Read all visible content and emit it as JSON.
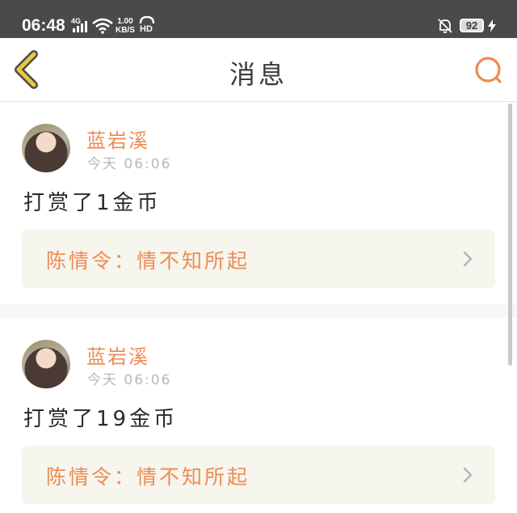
{
  "status_bar": {
    "time": "06:48",
    "network": "4G",
    "speed_value": "1.00",
    "speed_unit": "KB/S",
    "hd": "HD",
    "battery": "92"
  },
  "header": {
    "title": "消息"
  },
  "icons": {
    "back": "chevron-left-icon",
    "search": "search-icon",
    "forward": "chevron-right-icon"
  },
  "colors": {
    "accent": "#ee8b53",
    "back_icon": "#e8c93a",
    "source_bg": "#f6f5ee"
  },
  "messages": [
    {
      "user": "蓝岩溪",
      "time": "今天 06:06",
      "text": "打赏了1金币",
      "source": "陈情令：情不知所起"
    },
    {
      "user": "蓝岩溪",
      "time": "今天 06:06",
      "text": "打赏了19金币",
      "source": "陈情令：情不知所起"
    }
  ]
}
